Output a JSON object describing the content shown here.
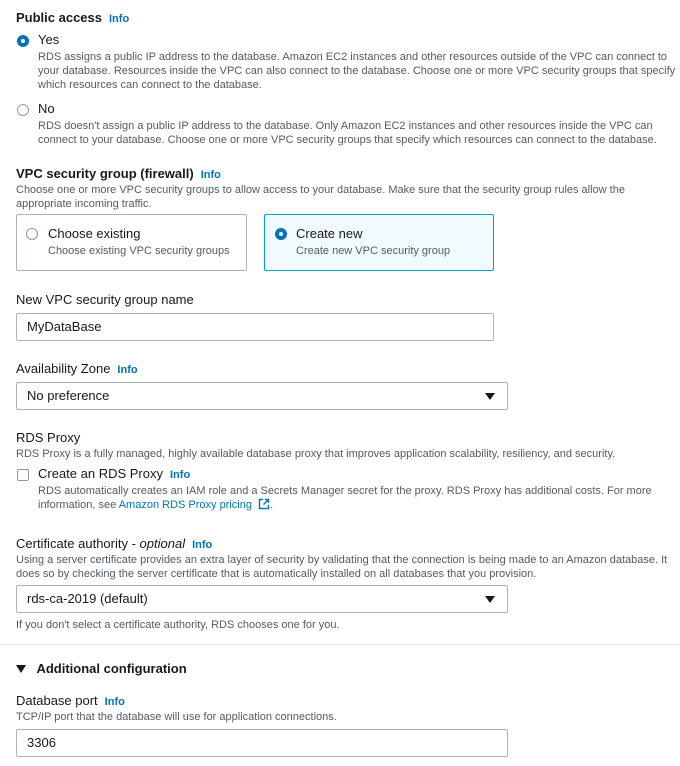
{
  "info_label": "Info",
  "public_access": {
    "label": "Public access",
    "options": [
      {
        "title": "Yes",
        "checked": true,
        "description": "RDS assigns a public IP address to the database. Amazon EC2 instances and other resources outside of the VPC can connect to your database. Resources inside the VPC can also connect to the database. Choose one or more VPC security groups that specify which resources can connect to the database."
      },
      {
        "title": "No",
        "checked": false,
        "description": "RDS doesn't assign a public IP address to the database. Only Amazon EC2 instances and other resources inside the VPC can connect to your database. Choose one or more VPC security groups that specify which resources can connect to the database."
      }
    ]
  },
  "vpc_security_group": {
    "label": "VPC security group (firewall)",
    "description": "Choose one or more VPC security groups to allow access to your database. Make sure that the security group rules allow the appropriate incoming traffic.",
    "cards": [
      {
        "title": "Choose existing",
        "subtitle": "Choose existing VPC security groups",
        "selected": false
      },
      {
        "title": "Create new",
        "subtitle": "Create new VPC security group",
        "selected": true
      }
    ]
  },
  "new_sg_name": {
    "label": "New VPC security group name",
    "value": "MyDataBase"
  },
  "availability_zone": {
    "label": "Availability Zone",
    "value": "No preference"
  },
  "rds_proxy": {
    "label": "RDS Proxy",
    "description": "RDS Proxy is a fully managed, highly available database proxy that improves application scalability, resiliency, and security.",
    "checkbox_label": "Create an RDS Proxy",
    "checked": false,
    "checkbox_description": "RDS automatically creates an IAM role and a Secrets Manager secret for the proxy. RDS Proxy has additional costs. For more information, see ",
    "link_text": "Amazon RDS Proxy pricing",
    "link_suffix": "."
  },
  "certificate_authority": {
    "label": "Certificate authority - ",
    "label_optional": "optional",
    "description": "Using a server certificate provides an extra layer of security by validating that the connection is being made to an Amazon database. It does so by checking the server certificate that is automatically installed on all databases that you provision.",
    "value": "rds-ca-2019 (default)",
    "hint": "If you don't select a certificate authority, RDS chooses one for you."
  },
  "additional_configuration": {
    "label": "Additional configuration",
    "expanded": true
  },
  "database_port": {
    "label": "Database port",
    "description": "TCP/IP port that the database will use for application connections.",
    "value": "3306"
  }
}
